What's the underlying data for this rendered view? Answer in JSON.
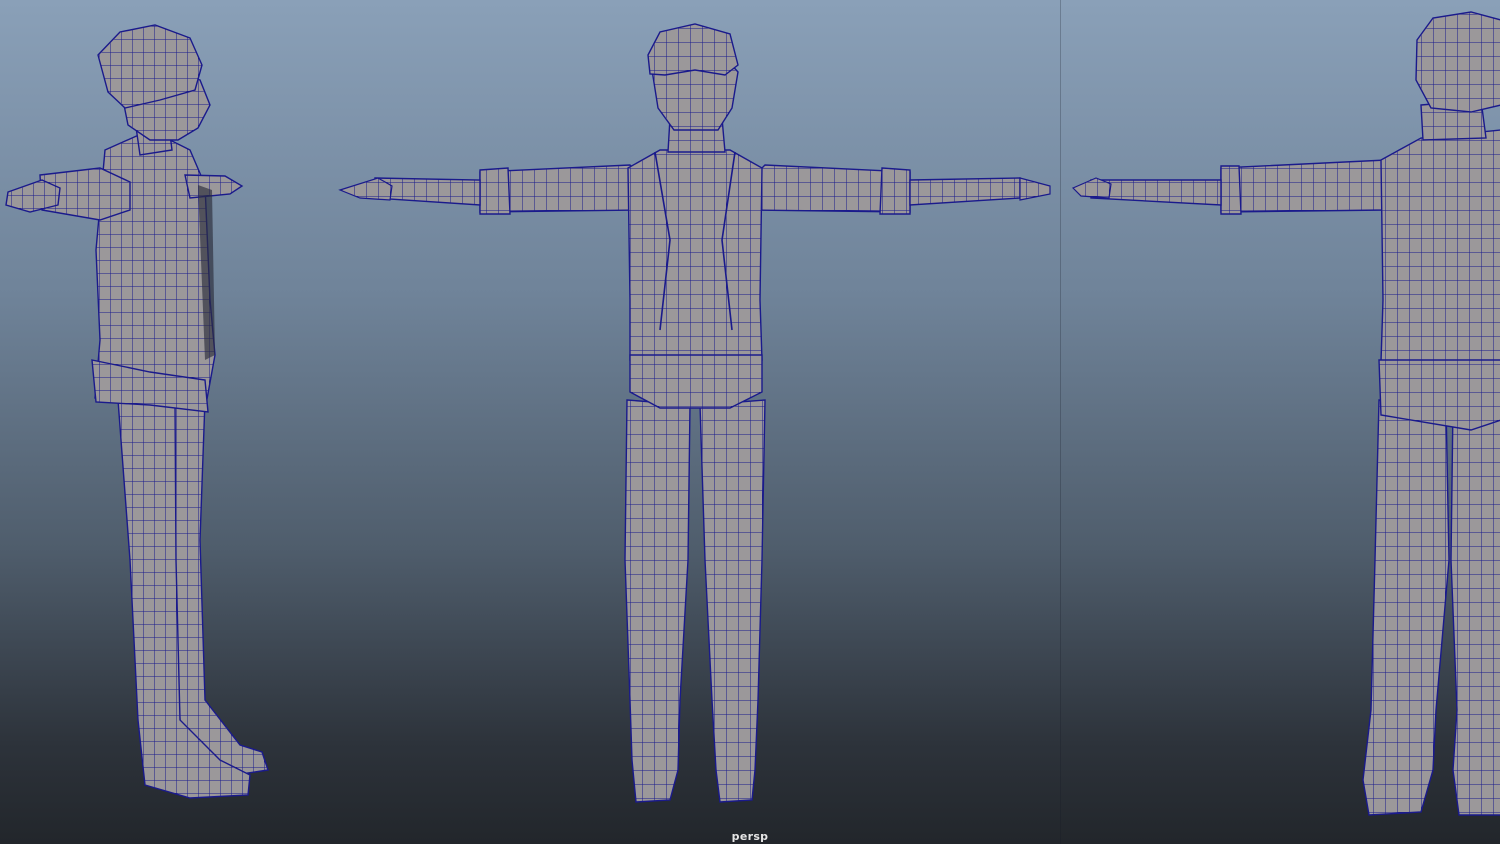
{
  "viewport": {
    "camera_label": "persp",
    "background_top": "#8aa0b8",
    "background_bottom": "#22262b"
  },
  "model": {
    "surface_color": "#9b989a",
    "wireframe_color": "#1a1a8c",
    "views": [
      "side-view",
      "front-view",
      "back-view"
    ]
  }
}
